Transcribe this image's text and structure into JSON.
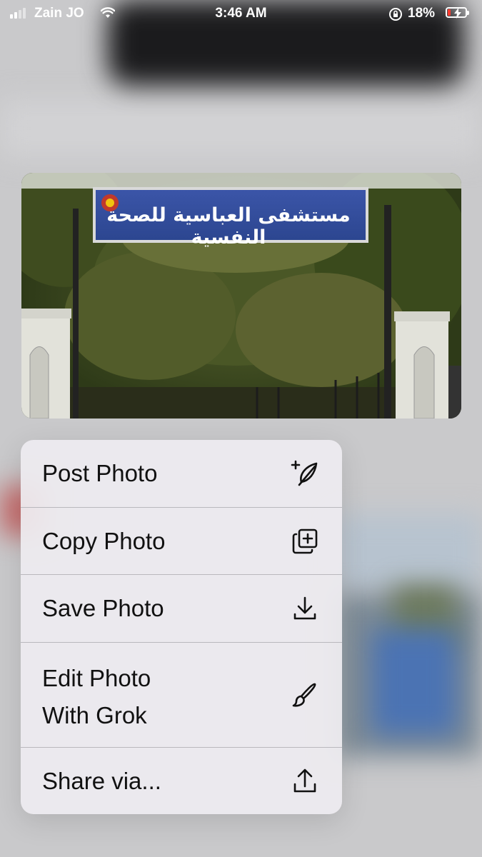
{
  "status_bar": {
    "carrier": "Zain JO",
    "time": "3:46 AM",
    "battery_percent": "18%",
    "battery_level": 0.18,
    "battery_color": "#ff3b30"
  },
  "photo": {
    "sign_text": "مستشفى العباسية للصحة النفسية"
  },
  "menu": {
    "items": [
      {
        "label": "Post Photo",
        "icon": "compose-feather-icon"
      },
      {
        "label": "Copy Photo",
        "icon": "copy-add-icon"
      },
      {
        "label": "Save Photo",
        "icon": "download-icon"
      },
      {
        "label": "Edit Photo With Grok",
        "line1": "Edit Photo",
        "line2": "With Grok",
        "icon": "paintbrush-icon"
      },
      {
        "label": "Share via...",
        "icon": "share-icon"
      }
    ]
  }
}
